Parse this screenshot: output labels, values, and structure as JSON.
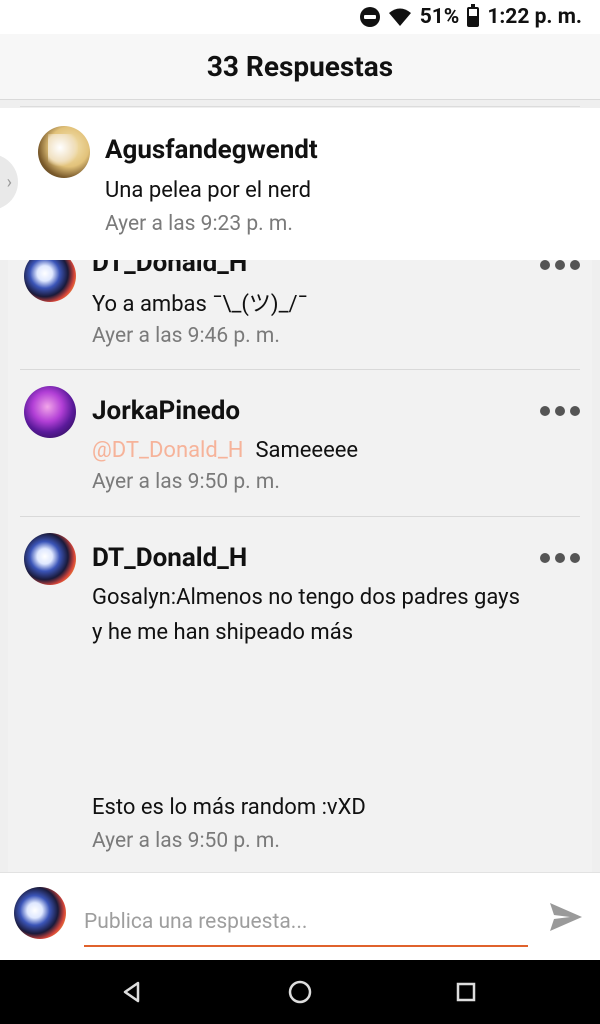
{
  "status_bar": {
    "battery": "51%",
    "time": "1:22 p. m.",
    "icons": [
      "do-not-disturb-icon",
      "wifi-icon",
      "battery-icon"
    ]
  },
  "header": {
    "title": "33 Respuestas"
  },
  "main_comment": {
    "username": "Agusfandegwendt",
    "text": "Una pelea por el nerd",
    "time": "Ayer a las 9:23 p. m."
  },
  "replies": [
    {
      "username": "DT_Donald_H",
      "text": "Yo a ambas ¯\\_(ツ)_/¯",
      "time": "Ayer a las 9:46 p. m."
    },
    {
      "username": "JorkaPinedo",
      "mention": "@DT_Donald_H",
      "text": "Sameeeee",
      "time": "Ayer a las 9:50 p. m."
    },
    {
      "username": "DT_Donald_H",
      "text_line1": "Gosalyn:Almenos no tengo dos padres gays",
      "text_line2": "y he me han shipeado más",
      "text_after": "Esto es lo más random :vXD",
      "time": "Ayer a las 9:50 p. m."
    }
  ],
  "compose": {
    "placeholder": "Publica una respuesta...",
    "accent_color": "#e0622c"
  },
  "nav": [
    "back-icon",
    "home-icon",
    "recents-icon"
  ]
}
